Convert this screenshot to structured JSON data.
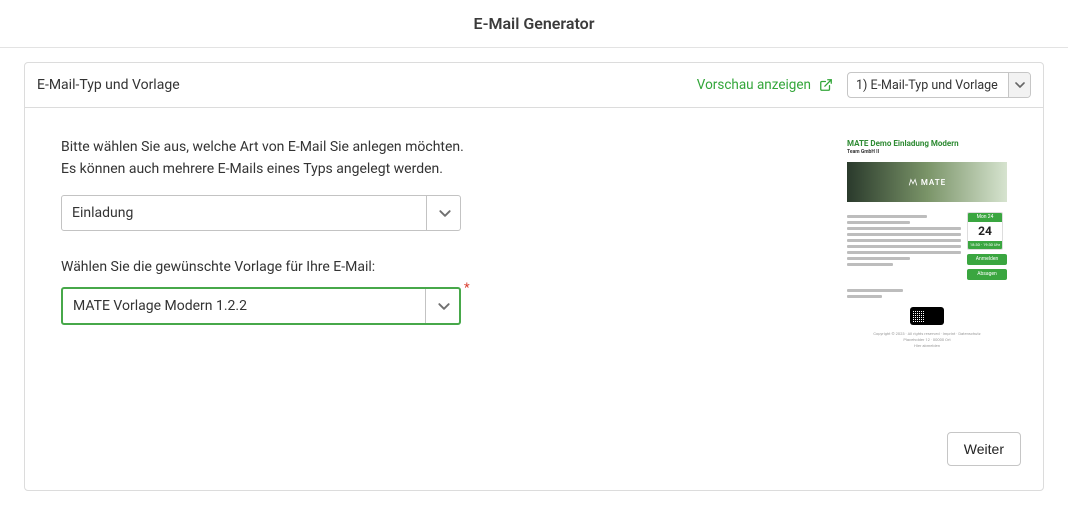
{
  "pageTitle": "E-Mail Generator",
  "panel": {
    "heading": "E-Mail-Typ und Vorlage",
    "previewLabel": "Vorschau anzeigen",
    "stepSelectValue": "1) E-Mail-Typ und Vorlage"
  },
  "body": {
    "intro1": "Bitte wählen Sie aus, welche Art von E-Mail Sie anlegen möchten.",
    "intro2": "Es können auch mehrere E-Mails eines Typs angelegt werden.",
    "emailTypeValue": "Einladung",
    "templateLabel": "Wählen Sie die gewünschte Vorlage für Ihre E-Mail:",
    "templateValue": "MATE Vorlage Modern 1.2.2"
  },
  "footer": {
    "nextLabel": "Weiter"
  },
  "thumb": {
    "title": "MATE Demo Einladung Modern",
    "logoText": "MATE",
    "dayNum": "24"
  }
}
